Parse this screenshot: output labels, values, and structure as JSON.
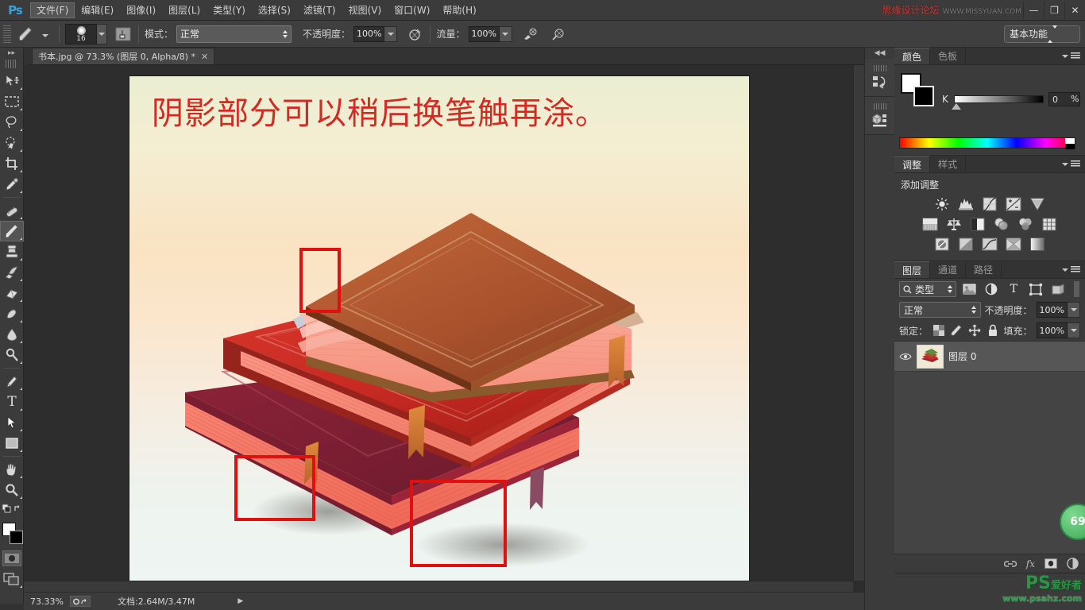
{
  "app": {
    "name": "Photoshop",
    "logo": "Ps"
  },
  "window_controls": {
    "minimize": "—",
    "restore": "❐",
    "close": "✕"
  },
  "watermark_top": {
    "text": "思缘设计论坛",
    "url": "WWW.MISSYUAN.COM"
  },
  "watermark_bottom": {
    "brand": "PS",
    "brand_cn": "爱好者",
    "url": "www.psahz.com"
  },
  "menubar": {
    "items": [
      {
        "label": "文件(F)",
        "active": true
      },
      {
        "label": "编辑(E)",
        "active": false
      },
      {
        "label": "图像(I)",
        "active": false
      },
      {
        "label": "图层(L)",
        "active": false
      },
      {
        "label": "类型(Y)",
        "active": false
      },
      {
        "label": "选择(S)",
        "active": false
      },
      {
        "label": "滤镜(T)",
        "active": false
      },
      {
        "label": "视图(V)",
        "active": false
      },
      {
        "label": "窗口(W)",
        "active": false
      },
      {
        "label": "帮助(H)",
        "active": false
      }
    ]
  },
  "options_bar": {
    "tool_icon": "brush-icon",
    "brush_size": "16",
    "airbrush_toggle_icon": "brush-panel-icon",
    "mode_label": "模式：",
    "mode_value": "正常",
    "opacity_label": "不透明度：",
    "opacity_value": "100%",
    "opacity_pressure_icon": "pressure-opacity-icon",
    "flow_label": "流量：",
    "flow_value": "100%",
    "airbrush_icon": "airbrush-icon",
    "pressure_size_icon": "pressure-size-icon",
    "workspace": "基本功能"
  },
  "document_tab": {
    "title": "书本.jpg @ 73.3% (图层 0, Alpha/8) *",
    "close": "✕"
  },
  "toolbar": {
    "tools": [
      {
        "name": "move-tool",
        "selected": false
      },
      {
        "name": "rectangular-marquee-tool",
        "selected": false
      },
      {
        "name": "lasso-tool",
        "selected": false
      },
      {
        "name": "quick-selection-tool",
        "selected": false
      },
      {
        "name": "crop-tool",
        "selected": false
      },
      {
        "name": "eyedropper-tool",
        "selected": false
      },
      {
        "name": "spot-healing-brush-tool",
        "selected": false
      },
      {
        "name": "brush-tool",
        "selected": true
      },
      {
        "name": "clone-stamp-tool",
        "selected": false
      },
      {
        "name": "history-brush-tool",
        "selected": false
      },
      {
        "name": "eraser-tool",
        "selected": false
      },
      {
        "name": "gradient-tool",
        "selected": false
      },
      {
        "name": "blur-tool",
        "selected": false
      },
      {
        "name": "dodge-tool",
        "selected": false
      },
      {
        "name": "pen-tool",
        "selected": false
      },
      {
        "name": "horizontal-type-tool",
        "selected": false
      },
      {
        "name": "path-selection-tool",
        "selected": false
      },
      {
        "name": "rectangle-tool",
        "selected": false
      },
      {
        "name": "hand-tool",
        "selected": false
      },
      {
        "name": "zoom-tool",
        "selected": false
      }
    ],
    "type_glyph": "T",
    "foreground_color": "#ffffff",
    "background_color": "#000000",
    "quick_mask_icon": "quick-mask-icon",
    "screen_mode_icon": "screen-mode-icon"
  },
  "canvas": {
    "annotation_text": "阴影部分可以稍后换笔触再涂。",
    "annotation_color": "#d42a22",
    "highlight_boxes": 3,
    "highlight_color": "#e01010"
  },
  "statusbar": {
    "zoom": "73.33%",
    "doc_label": "文档",
    "doc_value": "文档:2.64M/3.47M",
    "arrow": "▶"
  },
  "dock_rail": {
    "items": [
      {
        "name": "history-panel-icon"
      },
      {
        "name": "3d-panel-icon"
      }
    ],
    "collapse": "◀◀"
  },
  "color_panel": {
    "tabs": [
      {
        "label": "颜色",
        "active": true
      },
      {
        "label": "色板",
        "active": false
      }
    ],
    "channel_label": "K",
    "channel_value": "0",
    "percent": "%",
    "foreground": "#ffffff",
    "background": "#000000"
  },
  "adjustments_panel": {
    "tabs": [
      {
        "label": "调整",
        "active": true
      },
      {
        "label": "样式",
        "active": false
      }
    ],
    "title": "添加调整",
    "rows": [
      [
        "brightness-contrast-icon",
        "levels-icon",
        "curves-icon",
        "exposure-icon",
        "vibrance-icon"
      ],
      [
        "hue-saturation-icon",
        "color-balance-icon",
        "black-white-icon",
        "photo-filter-icon",
        "channel-mixer-icon",
        "color-lookup-icon"
      ],
      [
        "invert-icon",
        "posterize-icon",
        "threshold-icon",
        "gradient-map-icon",
        "selective-color-icon"
      ]
    ]
  },
  "layers_panel": {
    "tabs": [
      {
        "label": "图层",
        "active": true
      },
      {
        "label": "通道",
        "active": false
      },
      {
        "label": "路径",
        "active": false
      }
    ],
    "filter_label": "类型",
    "filter_icons": [
      "pixel-layer-filter-icon",
      "adjustment-layer-filter-icon",
      "type-layer-filter-icon",
      "shape-layer-filter-icon",
      "smart-object-filter-icon"
    ],
    "blend_mode": "正常",
    "opacity_label": "不透明度：",
    "opacity_value": "100%",
    "lock_label": "锁定：",
    "lock_icons": [
      "lock-transparent-pixels-icon",
      "lock-image-pixels-icon",
      "lock-position-icon",
      "lock-all-icon"
    ],
    "fill_label": "填充：",
    "fill_value": "100%",
    "layers": [
      {
        "name": "图层 0",
        "visible": true,
        "selected": true
      }
    ],
    "bottom_icons": [
      "link-layers-icon",
      "layer-style-fx-icon",
      "add-layer-mask-icon",
      "new-adjustment-layer-icon"
    ],
    "fx_label": "fx"
  },
  "badge": {
    "value": "69"
  }
}
